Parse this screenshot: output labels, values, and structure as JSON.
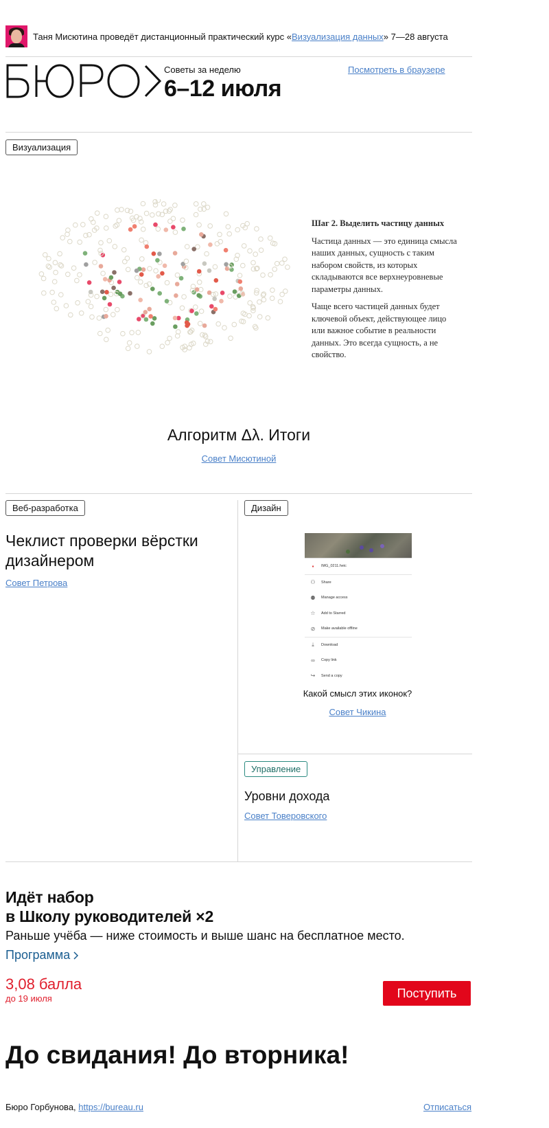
{
  "banner": {
    "text_before": "Таня Мисютина проведёт дистанционный практический курс «",
    "course_link": "Визуализация данных",
    "text_after": "» 7—28 августа"
  },
  "header": {
    "logo": "БЮРО",
    "week_label": "Советы за неделю",
    "week_dates": "6–12 июля",
    "browser_link": "Посмотреть в браузере"
  },
  "featured": {
    "tag": "Визуализация",
    "illustration": {
      "heading": "Шаг 2. Выделить частицу данных",
      "paragraph1": "Частица данных — это единица смысла наших данных, сущность с таким набором свойств, из которых складываются все верхнеуровневые параметры данных.",
      "paragraph2": "Чаще всего частицей данных будет ключевой объект, действующее лицо или важное событие в реальности данных. Это всегда сущность, а не свойство."
    },
    "title": "Алгоритм Δλ. Итоги",
    "author_link": "Совет Мисютиной"
  },
  "cards": {
    "web": {
      "tag": "Веб-разработка",
      "title": "Чеклист проверки вёрстки дизайнером",
      "author_link": "Совет Петрова"
    },
    "design": {
      "tag": "Дизайн",
      "caption": "Какой смысл этих иконок?",
      "author_link": "Совет Чикина",
      "menu": {
        "file_name": "IMG_0211.heic",
        "items": [
          "Share",
          "Manage access",
          "Add to Starred",
          "Make available offline",
          "Download",
          "Copy link",
          "Send a copy"
        ]
      }
    },
    "management": {
      "tag": "Управление",
      "title": "Уровни дохода",
      "author_link": "Совет Товеровского"
    }
  },
  "promo": {
    "title_line1": "Идёт набор",
    "title_line2": "в Школу руководителей ×2",
    "subtitle": "Раньше учёба — ниже стоимость и выше шанс на бесплатное место.",
    "program_link": "Программа",
    "score": "3,08 балла",
    "deadline": "до 19 июля",
    "apply_button": "Поступить"
  },
  "closing": "До свидания! До вторника!",
  "footer": {
    "org": "Бюро Горбунова,",
    "site_link": "https://bureau.ru",
    "unsubscribe": "Отписаться"
  },
  "colors": {
    "link": "#4a80c8",
    "accent_red": "#e2061b",
    "tag_teal": "#2a8a80",
    "divider": "#d6d6d6"
  }
}
